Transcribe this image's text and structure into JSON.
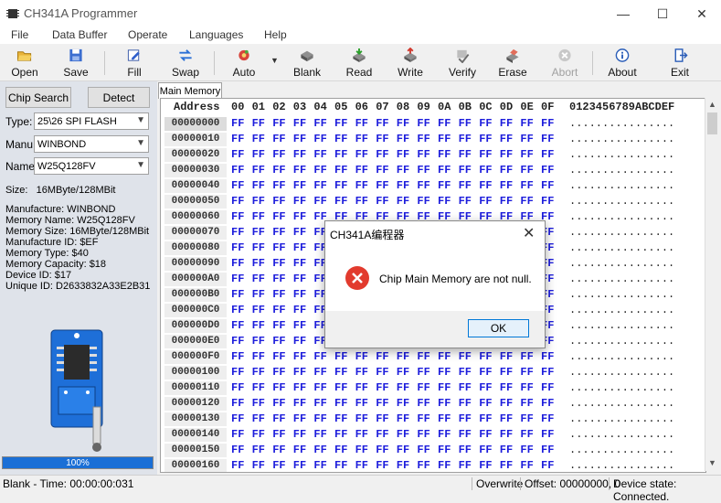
{
  "window": {
    "title": "CH341A Programmer",
    "min": "—",
    "max": "☐",
    "close": "✕"
  },
  "menu": [
    "File",
    "Data Buffer",
    "Operate",
    "Languages",
    "Help"
  ],
  "toolbar": {
    "open": "Open",
    "save": "Save",
    "fill": "Fill",
    "swap": "Swap",
    "auto": "Auto",
    "blank": "Blank",
    "read": "Read",
    "write": "Write",
    "verify": "Verify",
    "erase": "Erase",
    "abort": "Abort",
    "about": "About",
    "exit": "Exit"
  },
  "left": {
    "chip_search": "Chip Search",
    "detect": "Detect",
    "type_label": "Type:",
    "type_value": "25\\26 SPI FLASH",
    "manu_label": "Manu:",
    "manu_value": "WINBOND",
    "name_label": "Name:",
    "name_value": "W25Q128FV",
    "size_text": "Size:   16MByte/128MBit",
    "info": [
      "Manufacture: WINBOND",
      "Memory Name: W25Q128FV",
      "Memory Size: 16MByte/128MBit",
      "Manufacture ID: $EF",
      "Memory Type: $40",
      "Memory Capacity: $18",
      "Device ID: $17",
      "Unique ID: D2633832A33E2B31"
    ],
    "progress_value": 100,
    "progress_text": "100%"
  },
  "tab_label": "Main Memory",
  "hex": {
    "address_header": "Address",
    "columns": [
      "00",
      "01",
      "02",
      "03",
      "04",
      "05",
      "06",
      "07",
      "08",
      "09",
      "0A",
      "0B",
      "0C",
      "0D",
      "0E",
      "0F"
    ],
    "ascii_header": "0123456789ABCDEF",
    "rows": [
      "00000000",
      "00000010",
      "00000020",
      "00000030",
      "00000040",
      "00000050",
      "00000060",
      "00000070",
      "00000080",
      "00000090",
      "000000A0",
      "000000B0",
      "000000C0",
      "000000D0",
      "000000E0",
      "000000F0",
      "00000100",
      "00000110",
      "00000120",
      "00000130",
      "00000140",
      "00000150",
      "00000160"
    ],
    "byte": "FF",
    "ascii_row": "................"
  },
  "status": {
    "left": "Blank - Time: 00:00:00:031",
    "mode": "Overwrite",
    "offset": "Offset: 00000000, 0",
    "device": "Device state: Connected."
  },
  "dialog": {
    "title": "CH341A编程器",
    "message": "Chip Main Memory are not null.",
    "ok": "OK"
  }
}
